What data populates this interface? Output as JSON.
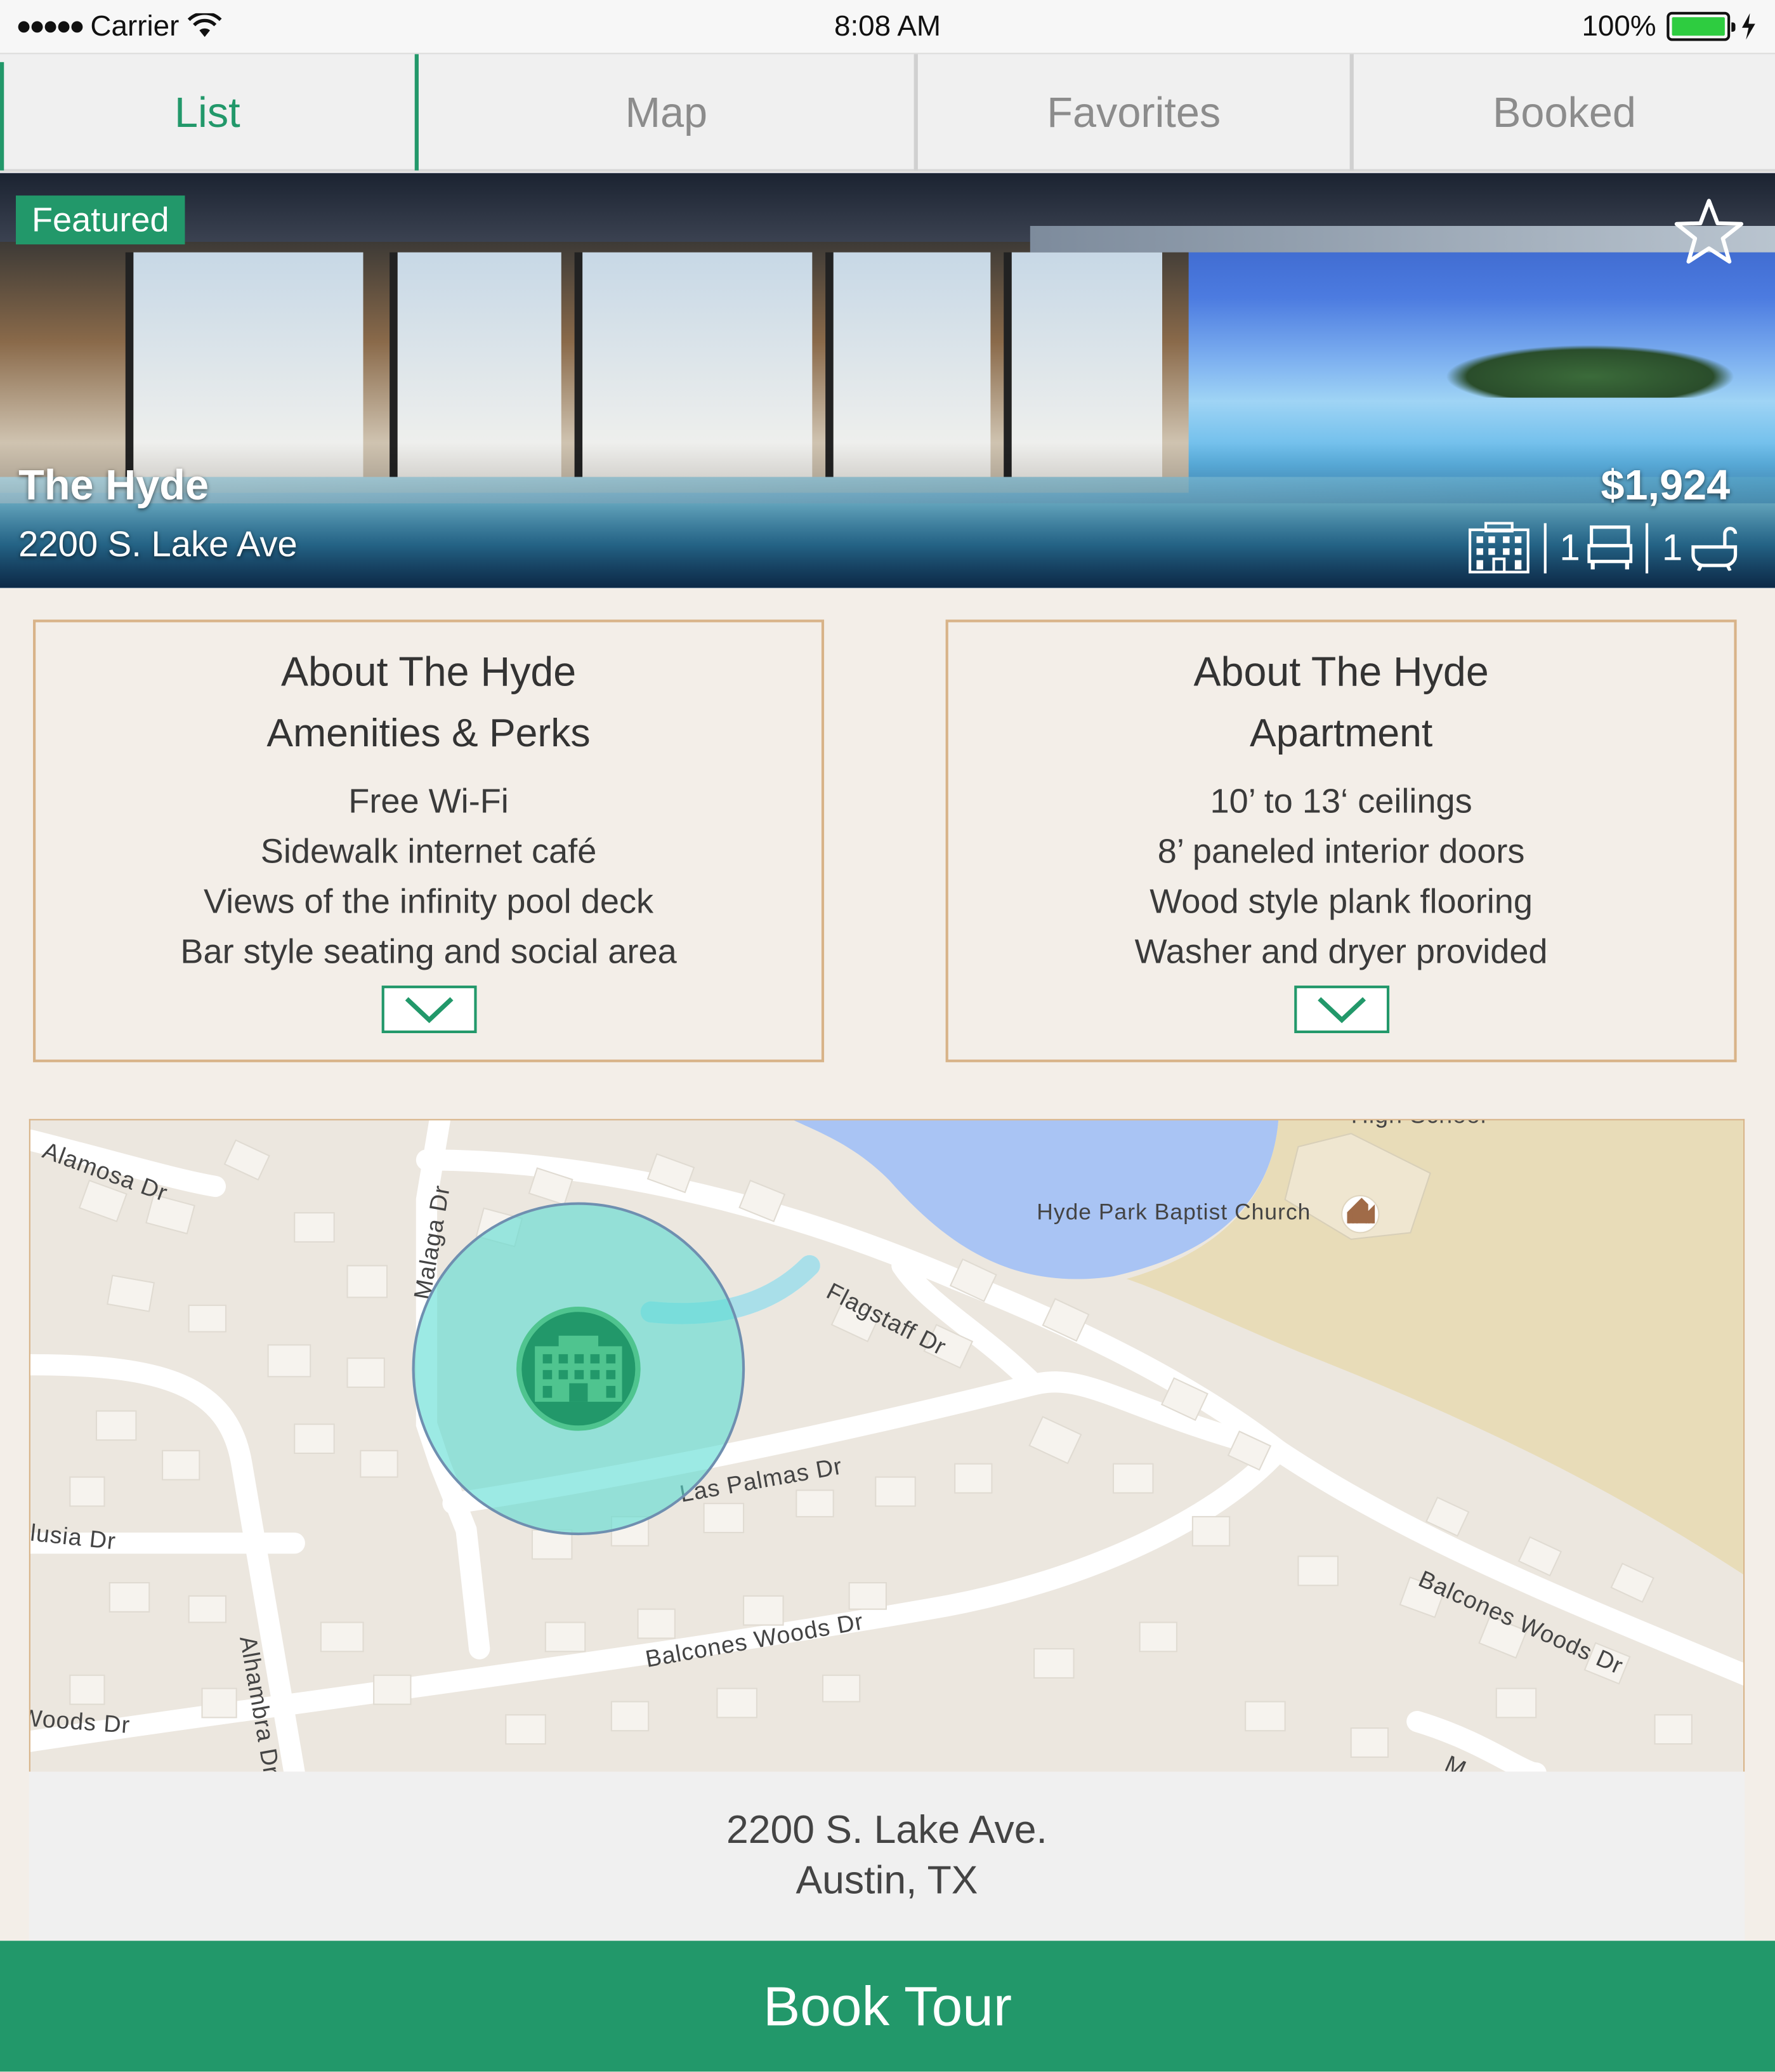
{
  "status_bar": {
    "carrier": "Carrier",
    "time": "8:08 AM",
    "battery": "100%"
  },
  "tabs": [
    {
      "label": "List",
      "active": true
    },
    {
      "label": "Map",
      "active": false
    },
    {
      "label": "Favorites",
      "active": false
    },
    {
      "label": "Booked",
      "active": false
    }
  ],
  "listing": {
    "badge": "Featured",
    "name": "The Hyde",
    "address": "2200 S. Lake Ave",
    "price": "$1,924",
    "beds": "1",
    "baths": "1"
  },
  "amenities_card": {
    "title": "About The Hyde",
    "subtitle": "Amenities & Perks",
    "items": [
      "Free Wi-Fi",
      "Sidewalk internet café",
      "Views of the infinity pool deck",
      "Bar style seating and social area"
    ]
  },
  "apartment_card": {
    "title": "About The Hyde",
    "subtitle": "Apartment",
    "items": [
      "10’ to 13‘ ceilings",
      "8’ paneled interior doors",
      "Wood style plank flooring",
      "Washer and dryer provided"
    ]
  },
  "map": {
    "labels": {
      "alamosa": "Alamosa Dr",
      "malaga": "Malaga Dr",
      "flagstaff": "Flagstaff Dr",
      "church": "Hyde Park Baptist Church",
      "high_school": "High School",
      "las_palmas": "Las Palmas Dr",
      "lusia": "lusia Dr",
      "balcones_center": "Balcones Woods Dr",
      "balcones_right": "Balcones Woods Dr",
      "woods_left": "Woods Dr",
      "alhambra": "Alhambra Dr",
      "m": "M"
    }
  },
  "map_address": {
    "line1": "2200 S. Lake Ave.",
    "line2": "Austin, TX"
  },
  "cta": {
    "label": "Book Tour"
  },
  "colors": {
    "brand_green": "#22986a",
    "card_border": "#d8b388",
    "background": "#f3eee8"
  }
}
